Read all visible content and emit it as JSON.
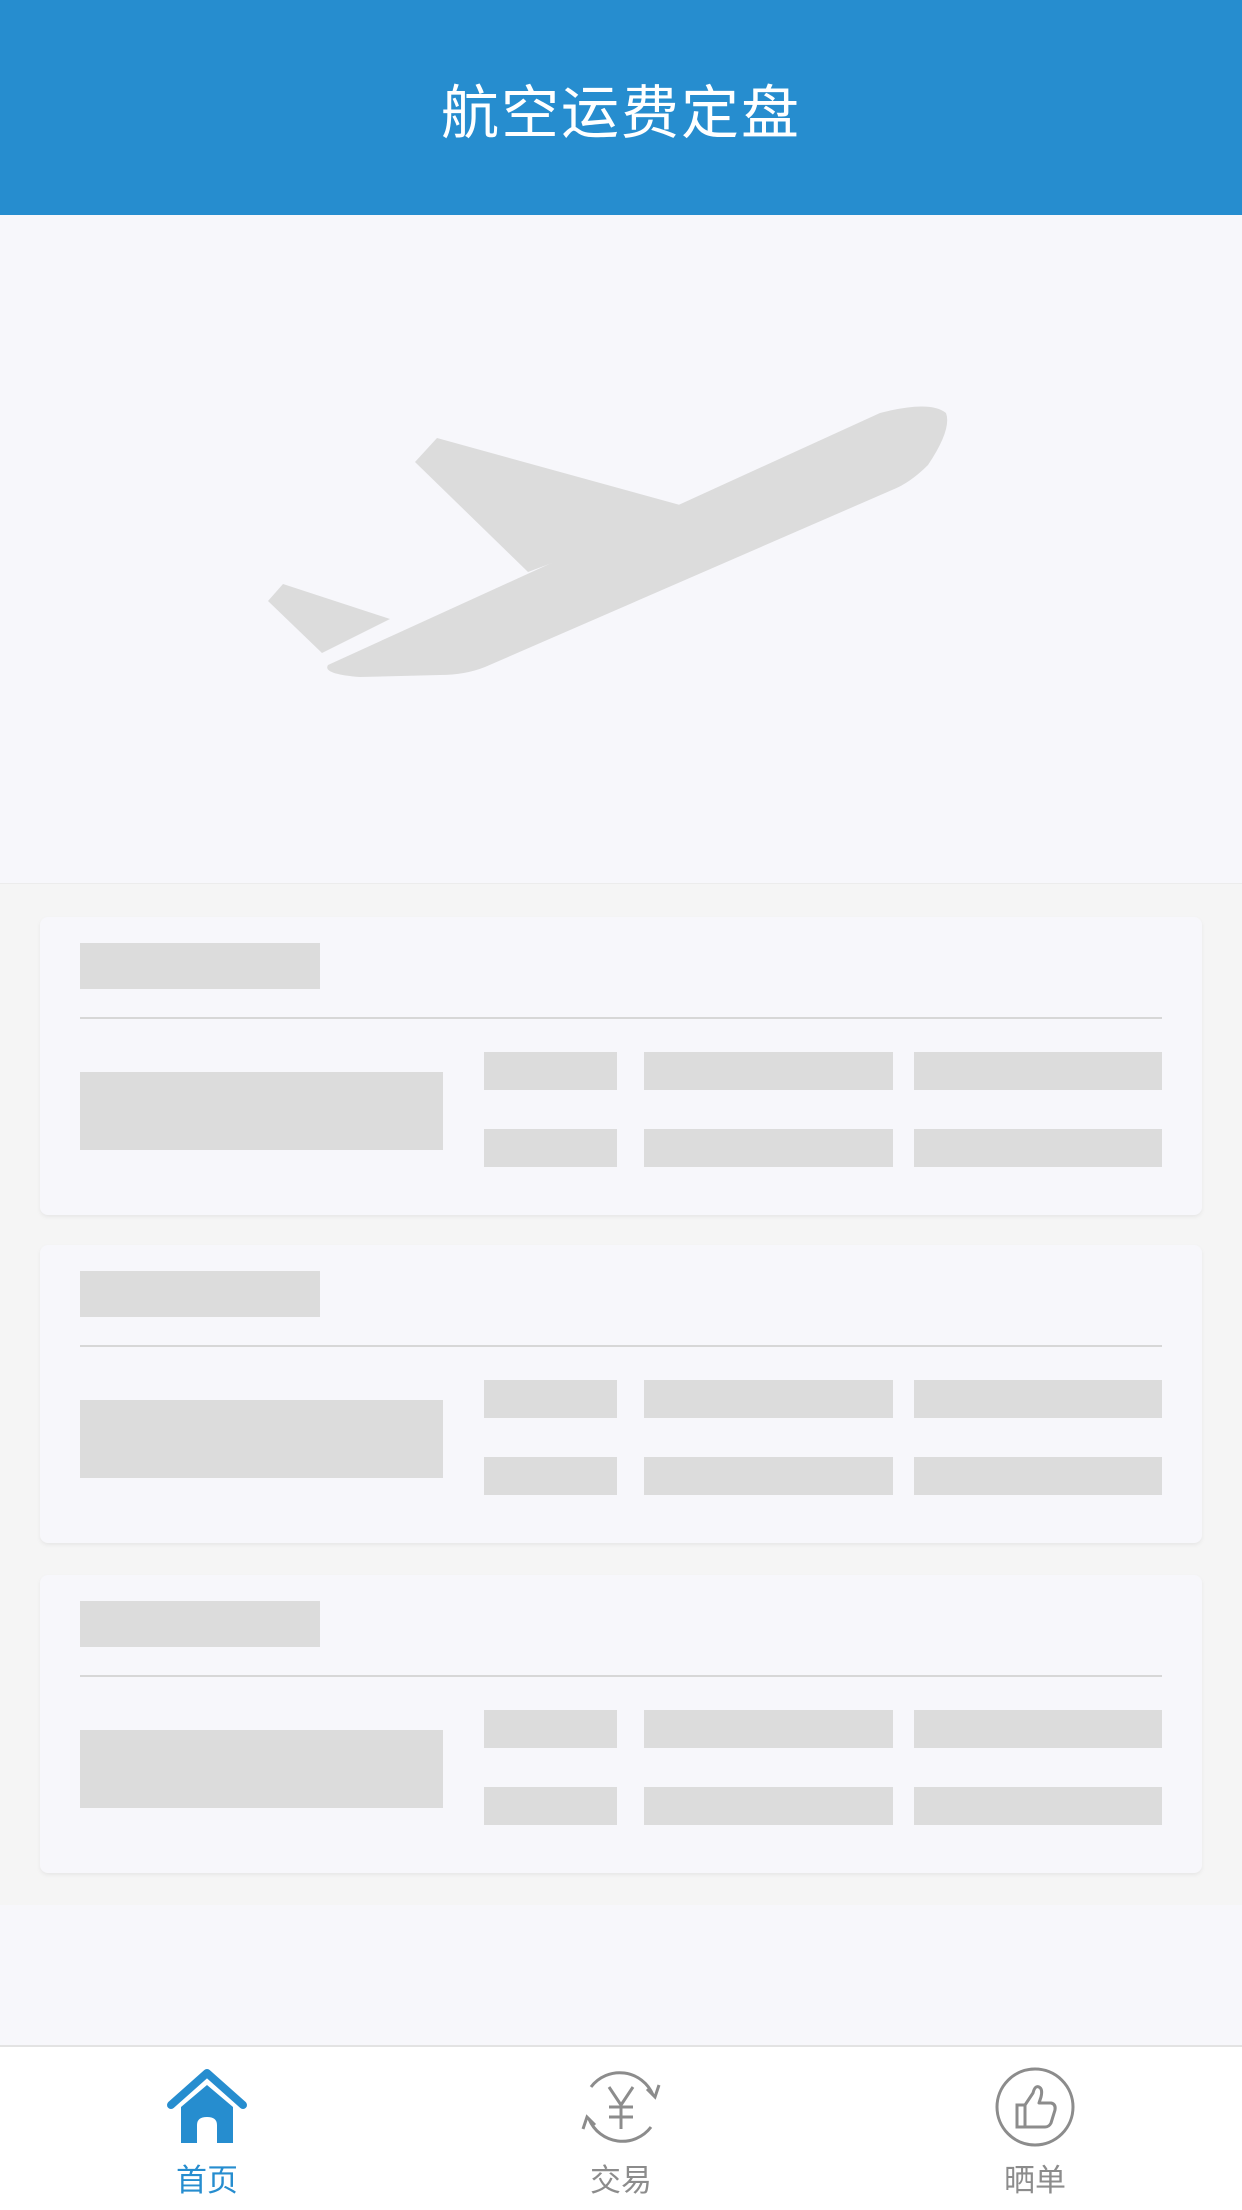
{
  "header": {
    "title": "航空运费定盘"
  },
  "banner": {
    "image_icon": "airplane-takeoff-icon",
    "placeholder_color": "#dcdcdc"
  },
  "cards": [
    {
      "state": "loading"
    },
    {
      "state": "loading"
    },
    {
      "state": "loading"
    }
  ],
  "tabbar": {
    "items": [
      {
        "label": "首页",
        "icon": "home-icon",
        "active": true
      },
      {
        "label": "交易",
        "icon": "yuan-exchange-icon",
        "active": false
      },
      {
        "label": "晒单",
        "icon": "thumbs-up-icon",
        "active": false
      }
    ]
  },
  "colors": {
    "brand": "#268dcf",
    "inactive": "#8c8c8c",
    "skeleton": "#dcdcdc"
  }
}
